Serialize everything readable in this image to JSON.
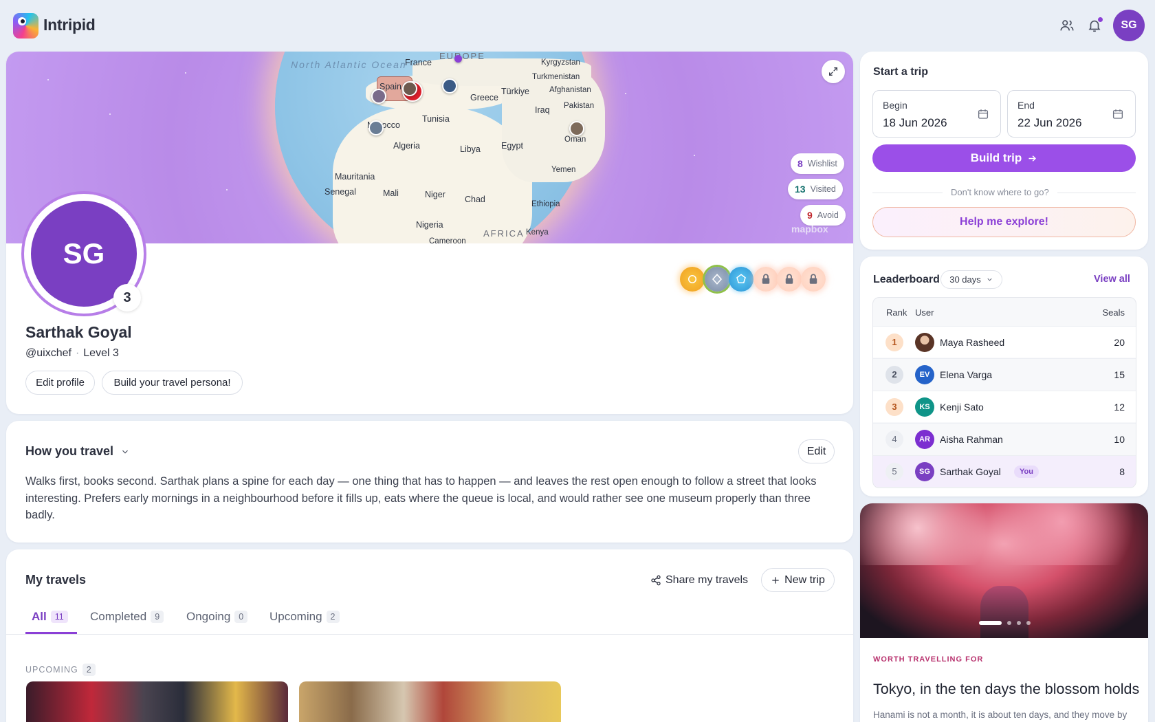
{
  "app": {
    "name": "Intripid",
    "avatar_initials": "SG"
  },
  "map": {
    "ocean_label": "North Atlantic Ocean",
    "region_labels": [
      "EUROPE",
      "AFRICA"
    ],
    "country_labels": [
      "Spain",
      "France",
      "Kyrgyzstan",
      "Turkmenistan",
      "Afghanistan",
      "Pakistan",
      "Greece",
      "Türkiye",
      "Iraq",
      "Tunisia",
      "Morocco",
      "Algeria",
      "Libya",
      "Egypt",
      "Oman",
      "Yemen",
      "Mauritania",
      "Senegal",
      "Mali",
      "Niger",
      "Chad",
      "Ethiopia",
      "Nigeria",
      "Cameroon",
      "Kenya"
    ],
    "attribution": "mapbox",
    "stats": {
      "wishlist": {
        "count": "8",
        "label": "Wishlist"
      },
      "visited": {
        "count": "13",
        "label": "Visited"
      },
      "avoid": {
        "count": "9",
        "label": "Avoid"
      }
    }
  },
  "profile": {
    "initials": "SG",
    "level_badge": "3",
    "name": "Sarthak Goyal",
    "handle": "@uixchef",
    "separator": "·",
    "level": "Level 3",
    "edit_label": "Edit profile",
    "persona_label": "Build your travel persona!"
  },
  "badges": [
    {
      "name": "gold",
      "color": "#f6b73c"
    },
    {
      "name": "silver",
      "color": "#8fa7c4"
    },
    {
      "name": "blue",
      "color": "#3fb1e8"
    },
    {
      "name": "locked",
      "color": "#ffd9c7"
    },
    {
      "name": "locked",
      "color": "#ffd9c7"
    },
    {
      "name": "locked",
      "color": "#ffd9c7"
    }
  ],
  "how_you_travel": {
    "title": "How you travel",
    "edit_label": "Edit",
    "body": "Walks first, books second. Sarthak plans a spine for each day — one thing that has to happen — and leaves the rest open enough to follow a street that looks interesting. Prefers early mornings in a neighbourhood before it fills up, eats where the queue is local, and would rather see one museum properly than three badly."
  },
  "my_travels": {
    "title": "My travels",
    "share_label": "Share my travels",
    "new_trip_label": "New trip",
    "tabs": [
      {
        "label": "All",
        "count": "11"
      },
      {
        "label": "Completed",
        "count": "9"
      },
      {
        "label": "Ongoing",
        "count": "0"
      },
      {
        "label": "Upcoming",
        "count": "2"
      }
    ],
    "section_label": "UPCOMING",
    "section_count": "2"
  },
  "start_trip": {
    "title": "Start a trip",
    "begin_label": "Begin",
    "begin_value": "18 Jun 2026",
    "end_label": "End",
    "end_value": "22 Jun 2026",
    "build_label": "Build trip",
    "divider_text": "Don't know where to go?",
    "explore_label": "Help me explore!"
  },
  "leaderboard": {
    "title": "Leaderboard",
    "period": "30 days",
    "view_all": "View all",
    "columns": {
      "rank": "Rank",
      "user": "User",
      "seals": "Seals"
    },
    "rows": [
      {
        "rank": "1",
        "initials": "",
        "name": "Maya Rasheed",
        "seals": "20",
        "avatar_color": "#8a5a3c",
        "rank_color": "#fde0c8"
      },
      {
        "rank": "2",
        "initials": "EV",
        "name": "Elena Varga",
        "seals": "15",
        "avatar_color": "#2563c9",
        "rank_color": "#dfe3ea"
      },
      {
        "rank": "3",
        "initials": "KS",
        "name": "Kenji Sato",
        "seals": "12",
        "avatar_color": "#0f9488",
        "rank_color": "#fde0c8"
      },
      {
        "rank": "4",
        "initials": "AR",
        "name": "Aisha Rahman",
        "seals": "10",
        "avatar_color": "#7c2fd0",
        "rank_color": "#eef0f4"
      },
      {
        "rank": "5",
        "initials": "SG",
        "name": "Sarthak Goyal",
        "seals": "8",
        "avatar_color": "#7a3fc2",
        "rank_color": "#eef0f4",
        "you": "You"
      }
    ]
  },
  "feature": {
    "kicker": "WORTH TRAVELLING FOR",
    "title": "Tokyo, in the ten days the blossom holds",
    "body": "Hanami is not a month, it is about ten days, and they move by"
  }
}
